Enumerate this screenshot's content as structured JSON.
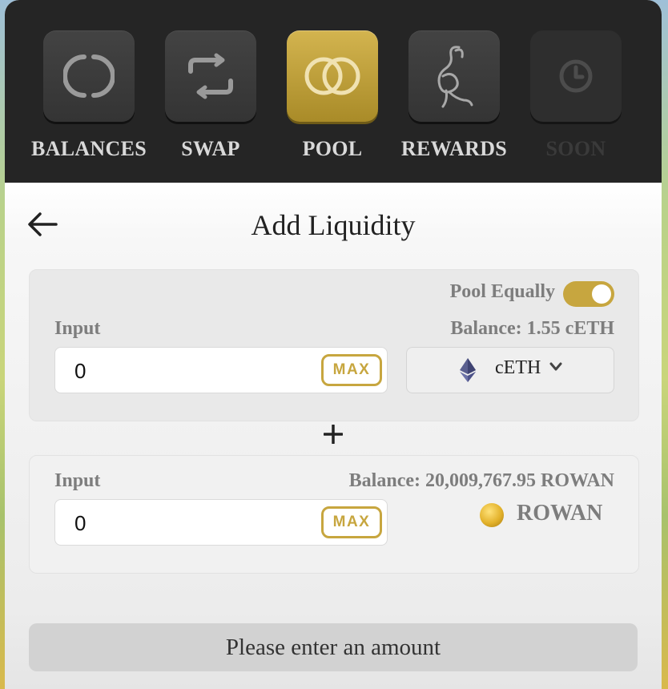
{
  "nav": {
    "items": [
      {
        "label": "BALANCES",
        "icon": "balances-icon",
        "state": "default"
      },
      {
        "label": "SWAP",
        "icon": "swap-icon",
        "state": "default"
      },
      {
        "label": "POOL",
        "icon": "pool-icon",
        "state": "active"
      },
      {
        "label": "REWARDS",
        "icon": "rewards-icon",
        "state": "default"
      },
      {
        "label": "SOON",
        "icon": "clock-icon",
        "state": "disabled"
      }
    ]
  },
  "header": {
    "title": "Add Liquidity",
    "back_icon": "arrow-left-icon"
  },
  "top_card": {
    "pool_equally_label": "Pool Equally",
    "pool_equally_on": true,
    "input_label": "Input",
    "balance": "Balance: 1.55 cETH",
    "input_value": "0",
    "max_label": "MAX",
    "token": {
      "name": "cETH",
      "icon": "ethereum-icon",
      "chevron": "chevron-down-icon"
    }
  },
  "plus_icon": "plus-icon",
  "bottom_card": {
    "input_label": "Input",
    "balance": "Balance: 20,009,767.95 ROWAN",
    "input_value": "0",
    "max_label": "MAX",
    "token": {
      "name": "ROWAN",
      "icon": "rowan-coin-icon"
    }
  },
  "submit_label": "Please enter an amount",
  "colors": {
    "gold": "#c7a63f",
    "dark": "#252525",
    "muted_text": "#7d7d7d"
  }
}
